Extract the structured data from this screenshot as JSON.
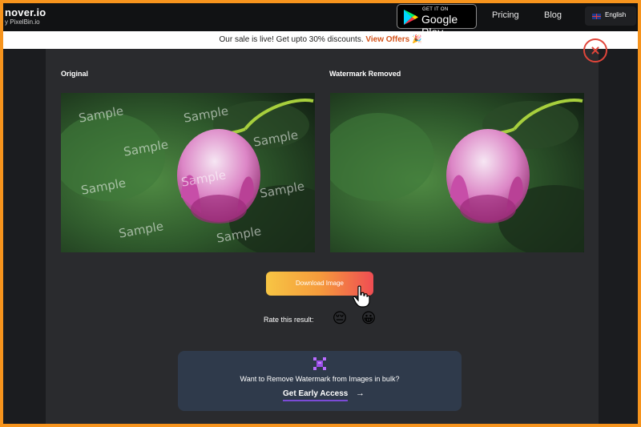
{
  "nav": {
    "logo": "nover.io",
    "logo_sub": "y PixelBin.io",
    "google_play_small": "GET IT ON",
    "google_play_big": "Google Play",
    "pricing": "Pricing",
    "blog": "Blog",
    "language": "English"
  },
  "sale": {
    "text": "Our sale is live! Get upto 30% discounts.",
    "link": "View Offers",
    "emoji": "🎉"
  },
  "result": {
    "original_title": "Original",
    "removed_title": "Watermark Removed",
    "watermark_text": "Sample",
    "download_label": "Download Image",
    "rate_label": "Rate this result:",
    "rate_bad": "😔",
    "rate_good": "😀"
  },
  "bulk": {
    "text": "Want to Remove Watermark from Images in bulk?",
    "cta": "Get Early Access",
    "arrow": "→"
  },
  "colors": {
    "page_border": "#f7941d",
    "accent_red": "#e0453a",
    "cta_underline": "#7b4bd6"
  }
}
